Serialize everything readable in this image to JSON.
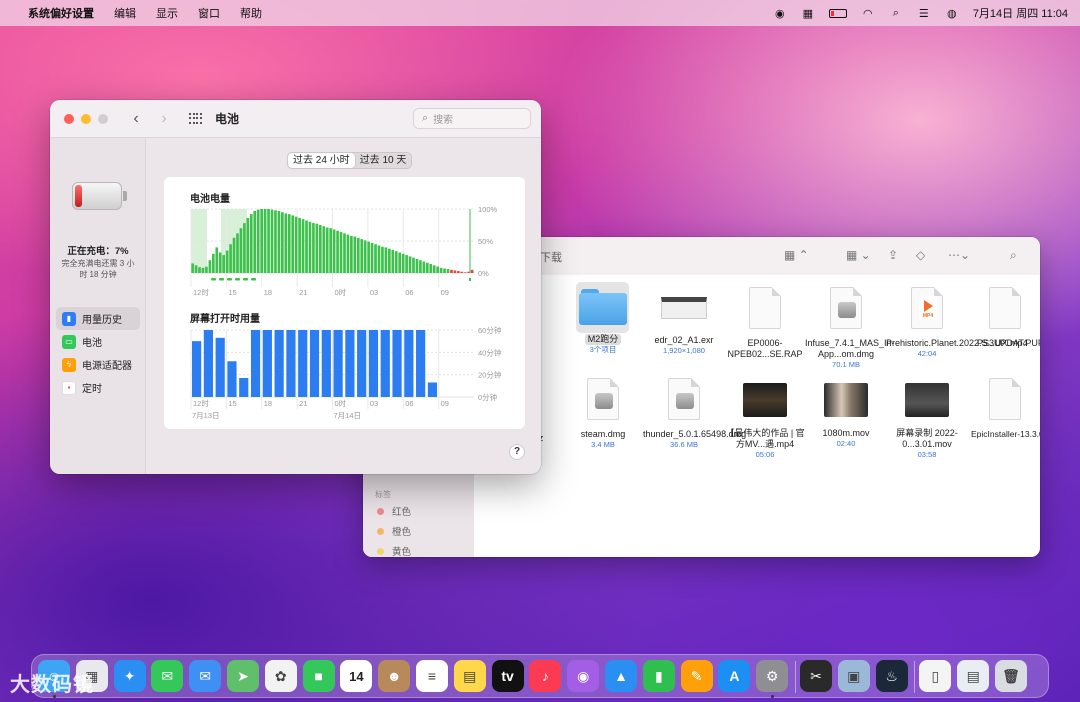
{
  "menubar": {
    "app_name": "系统偏好设置",
    "menus": [
      "编辑",
      "显示",
      "窗口",
      "帮助"
    ],
    "datetime": "7月14日 周四  11:04"
  },
  "battery_window": {
    "title": "电池",
    "search_placeholder": "搜索",
    "segment": [
      "过去 24 小时",
      "过去 10 天"
    ],
    "charge_status": "正在充电：7%",
    "charge_detail": "完全充满电还需 3 小时 18 分钟",
    "sidebar": [
      {
        "label": "用量历史",
        "icon": "chart-icon",
        "color": "#2f7cf6"
      },
      {
        "label": "电池",
        "icon": "battery-icon",
        "color": "#34c759"
      },
      {
        "label": "电源适配器",
        "icon": "bolt-icon",
        "color": "#ff9f0a"
      },
      {
        "label": "定时",
        "icon": "calendar-icon",
        "color": "#ff453a"
      }
    ],
    "help_label": "?"
  },
  "chart_data": [
    {
      "type": "bar",
      "title": "电池电量",
      "x_ticks": [
        "12时",
        "15",
        "18",
        "21",
        "0时",
        "03",
        "06",
        "09"
      ],
      "y_ticks": [
        "100%",
        "50%",
        "0%"
      ],
      "ylim": [
        0,
        100
      ],
      "values": [
        15,
        12,
        9,
        8,
        10,
        20,
        30,
        40,
        32,
        28,
        35,
        45,
        55,
        62,
        70,
        78,
        86,
        92,
        97,
        99,
        100,
        100,
        100,
        99,
        98,
        97,
        95,
        93,
        92,
        90,
        88,
        86,
        84,
        82,
        80,
        78,
        77,
        75,
        73,
        71,
        70,
        68,
        66,
        64,
        62,
        60,
        58,
        57,
        55,
        53,
        51,
        49,
        47,
        45,
        43,
        41,
        40,
        38,
        36,
        34,
        32,
        30,
        28,
        26,
        24,
        22,
        20,
        18,
        16,
        14,
        12,
        10,
        8,
        7,
        6,
        5,
        4,
        3,
        2,
        1,
        2,
        5
      ],
      "colors": {
        "normal": "#3cc24a",
        "low": "#e8463a",
        "charging_shade": "#d8efd8"
      }
    },
    {
      "type": "bar",
      "title": "屏幕打开时用量",
      "x_ticks": [
        "12时",
        "15",
        "18",
        "21",
        "0时",
        "03",
        "06",
        "09"
      ],
      "date_labels": [
        "7月13日",
        "7月14日"
      ],
      "y_ticks": [
        "60分钟",
        "40分钟",
        "20分钟",
        "0分钟"
      ],
      "ylim": [
        0,
        60
      ],
      "values": [
        50,
        60,
        53,
        32,
        17,
        60,
        60,
        60,
        60,
        60,
        60,
        60,
        60,
        60,
        60,
        60,
        60,
        60,
        60,
        60,
        13
      ],
      "color": "#2c7df2"
    }
  ],
  "finder": {
    "title": "下载",
    "tags_header": "标签",
    "tags": [
      {
        "label": "红色",
        "color": "#f08a8a"
      },
      {
        "label": "橙色",
        "color": "#f5b46a"
      },
      {
        "label": "黄色",
        "color": "#f1d46a"
      }
    ],
    "files": [
      {
        "name": "BIN",
        "meta": "",
        "kind": "partial"
      },
      {
        "name": "M2跑分",
        "meta": "3个项目",
        "kind": "folder"
      },
      {
        "name": "edr_02_A1.exr",
        "meta": "1,920×1,080",
        "kind": "strip"
      },
      {
        "name": "EP0006-NPEB02...SE.RAP",
        "meta": "",
        "kind": "doc"
      },
      {
        "name": "Infuse_7.4.1_MAS_In-App...om.dmg",
        "meta": "70.1 MB",
        "kind": "disk"
      },
      {
        "name": "Prehistoric.Planet.2022.S...UX.mp4",
        "meta": "42:04",
        "kind": "mp4"
      },
      {
        "name": "PS3UPDAT.PUP",
        "meta": "",
        "kind": "doc"
      },
      {
        "name": "N.7z",
        "meta": "",
        "kind": "partial"
      },
      {
        "name": "steam.dmg",
        "meta": "3.4 MB",
        "kind": "disk"
      },
      {
        "name": "thunder_5.0.1.65498.dmg",
        "meta": "36.6 MB",
        "kind": "disk"
      },
      {
        "name": "【最伟大的作品 | 官方MV...遇.mp4",
        "meta": "05:06",
        "kind": "thumb"
      },
      {
        "name": "1080m.mov",
        "meta": "02:40",
        "kind": "thumb"
      },
      {
        "name": "屏幕录制 2022-0...3.01.mov",
        "meta": "03:58",
        "kind": "thumb"
      },
      {
        "name": "EpicInstaller-13.3.0-4f28b...538.msi",
        "meta": "",
        "kind": "doc"
      }
    ]
  },
  "dock": {
    "apps": [
      {
        "name": "finder",
        "color": "#3da5f4",
        "glyph": "☺"
      },
      {
        "name": "launchpad",
        "color": "#e8e8ee",
        "glyph": "▦"
      },
      {
        "name": "safari",
        "color": "#2b8ef2",
        "glyph": "✦"
      },
      {
        "name": "messages",
        "color": "#34c759",
        "glyph": "✉"
      },
      {
        "name": "mail",
        "color": "#3f8ff5",
        "glyph": "✉"
      },
      {
        "name": "maps",
        "color": "#5fbf6a",
        "glyph": "➤"
      },
      {
        "name": "photos",
        "color": "#f2f2f2",
        "glyph": "✿"
      },
      {
        "name": "facetime",
        "color": "#34c759",
        "glyph": "■"
      },
      {
        "name": "calendar",
        "color": "#ffffff",
        "glyph": "14"
      },
      {
        "name": "contacts",
        "color": "#b8895a",
        "glyph": "☻"
      },
      {
        "name": "reminders",
        "color": "#ffffff",
        "glyph": "≡"
      },
      {
        "name": "notes",
        "color": "#ffd84a",
        "glyph": "▤"
      },
      {
        "name": "tv",
        "color": "#111111",
        "glyph": "tv"
      },
      {
        "name": "music",
        "color": "#fb3b54",
        "glyph": "♪"
      },
      {
        "name": "podcasts",
        "color": "#a45ee5",
        "glyph": "◉"
      },
      {
        "name": "keynote",
        "color": "#2b8ef2",
        "glyph": "▲"
      },
      {
        "name": "numbers",
        "color": "#2fbf4f",
        "glyph": "▮"
      },
      {
        "name": "pages",
        "color": "#ff9f0a",
        "glyph": "✎"
      },
      {
        "name": "app-store",
        "color": "#1d8ff3",
        "glyph": "A"
      },
      {
        "name": "system-preferences",
        "color": "#8e8e93",
        "glyph": "⚙"
      },
      {
        "name": "final-cut",
        "color": "#2a2a2a",
        "glyph": "✂"
      },
      {
        "name": "preview",
        "color": "#9bb8d8",
        "glyph": "▣"
      },
      {
        "name": "steam",
        "color": "#1b2838",
        "glyph": "♨"
      },
      {
        "name": "document",
        "color": "#f4f4f4",
        "glyph": "▯"
      },
      {
        "name": "screenshot",
        "color": "#e9eef5",
        "glyph": "▤"
      },
      {
        "name": "trash",
        "color": "#d9dde2",
        "glyph": "🗑"
      }
    ]
  },
  "watermark": "大数码镜"
}
